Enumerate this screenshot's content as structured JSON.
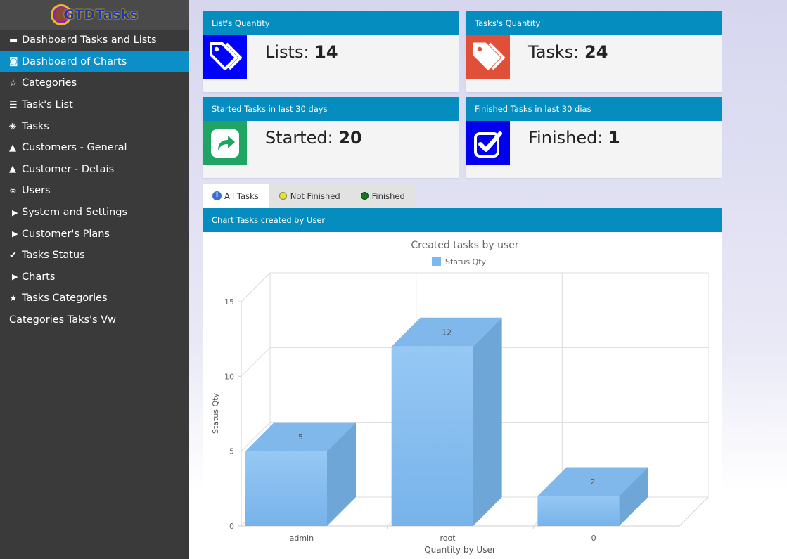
{
  "logo": {
    "text": "GTDTasks"
  },
  "sidebar": {
    "items": [
      {
        "label": "Dashboard Tasks and Lists",
        "icon": "card-icon",
        "glyph": "▬",
        "active": false
      },
      {
        "label": "Dashboard of Charts",
        "icon": "dashboard-icon",
        "glyph": "◙",
        "active": true
      },
      {
        "label": "Categories",
        "icon": "star-outline-icon",
        "glyph": "☆",
        "active": false
      },
      {
        "label": "Task's List",
        "icon": "list-icon",
        "glyph": "☰",
        "active": false
      },
      {
        "label": "Tasks",
        "icon": "tags-icon",
        "glyph": "◈",
        "active": false
      },
      {
        "label": "Customers - General",
        "icon": "user-icon",
        "glyph": "▲",
        "active": false
      },
      {
        "label": "Customer - Detais",
        "icon": "user-icon",
        "glyph": "▲",
        "active": false
      },
      {
        "label": "Users",
        "icon": "glasses-icon",
        "glyph": "∞",
        "active": false
      },
      {
        "label": "System and Settings",
        "icon": "caret-right-icon",
        "glyph": "▶",
        "active": false
      },
      {
        "label": "Customer's Plans",
        "icon": "caret-right-icon",
        "glyph": "▶",
        "active": false
      },
      {
        "label": "Tasks Status",
        "icon": "check-icon",
        "glyph": "✔",
        "active": false
      },
      {
        "label": "Charts",
        "icon": "caret-right-icon",
        "glyph": "▶",
        "active": false
      },
      {
        "label": "Tasks Categories",
        "icon": "star-icon",
        "glyph": "★",
        "active": false
      },
      {
        "label": "Categories Taks's Vw",
        "icon": "",
        "glyph": "",
        "active": false
      }
    ]
  },
  "cards": {
    "lists": {
      "header": "List's Quantity",
      "label": "Lists: ",
      "value": "14",
      "icon_color": "#0000ff"
    },
    "tasks": {
      "header": "Tasks's Quantity",
      "label": "Tasks: ",
      "value": "24",
      "icon_color": "#e05038"
    },
    "started": {
      "header": "Started Tasks in last 30 days",
      "label": "Started: ",
      "value": "20",
      "icon_color": "#1fa463"
    },
    "finished": {
      "header": "Finished Tasks in last 30 dias",
      "label": "Finished: ",
      "value": "1",
      "icon_color": "#0000ee"
    }
  },
  "tabs": [
    {
      "label": "All Tasks",
      "icon": "info-icon",
      "active": true
    },
    {
      "label": "Not Finished",
      "icon": "yellow-dot-icon",
      "active": false
    },
    {
      "label": "Finished",
      "icon": "green-dot-icon",
      "active": false
    }
  ],
  "chart_panel": {
    "header": "Chart Tasks created by User"
  },
  "chart_data": {
    "type": "bar",
    "title": "Created tasks by user",
    "legend": [
      "Status Qty"
    ],
    "legend_position": "top-center",
    "categories": [
      "admin",
      "root",
      "0"
    ],
    "series": [
      {
        "name": "Status Qty",
        "values": [
          5,
          12,
          2
        ]
      }
    ],
    "xlabel": "Quantity by User",
    "ylabel": "Status Qty",
    "ylim": [
      0,
      15
    ],
    "yticks": [
      0,
      5,
      10,
      15
    ],
    "grid": true,
    "three_d": true,
    "bar_color": "#7cb9ee"
  }
}
